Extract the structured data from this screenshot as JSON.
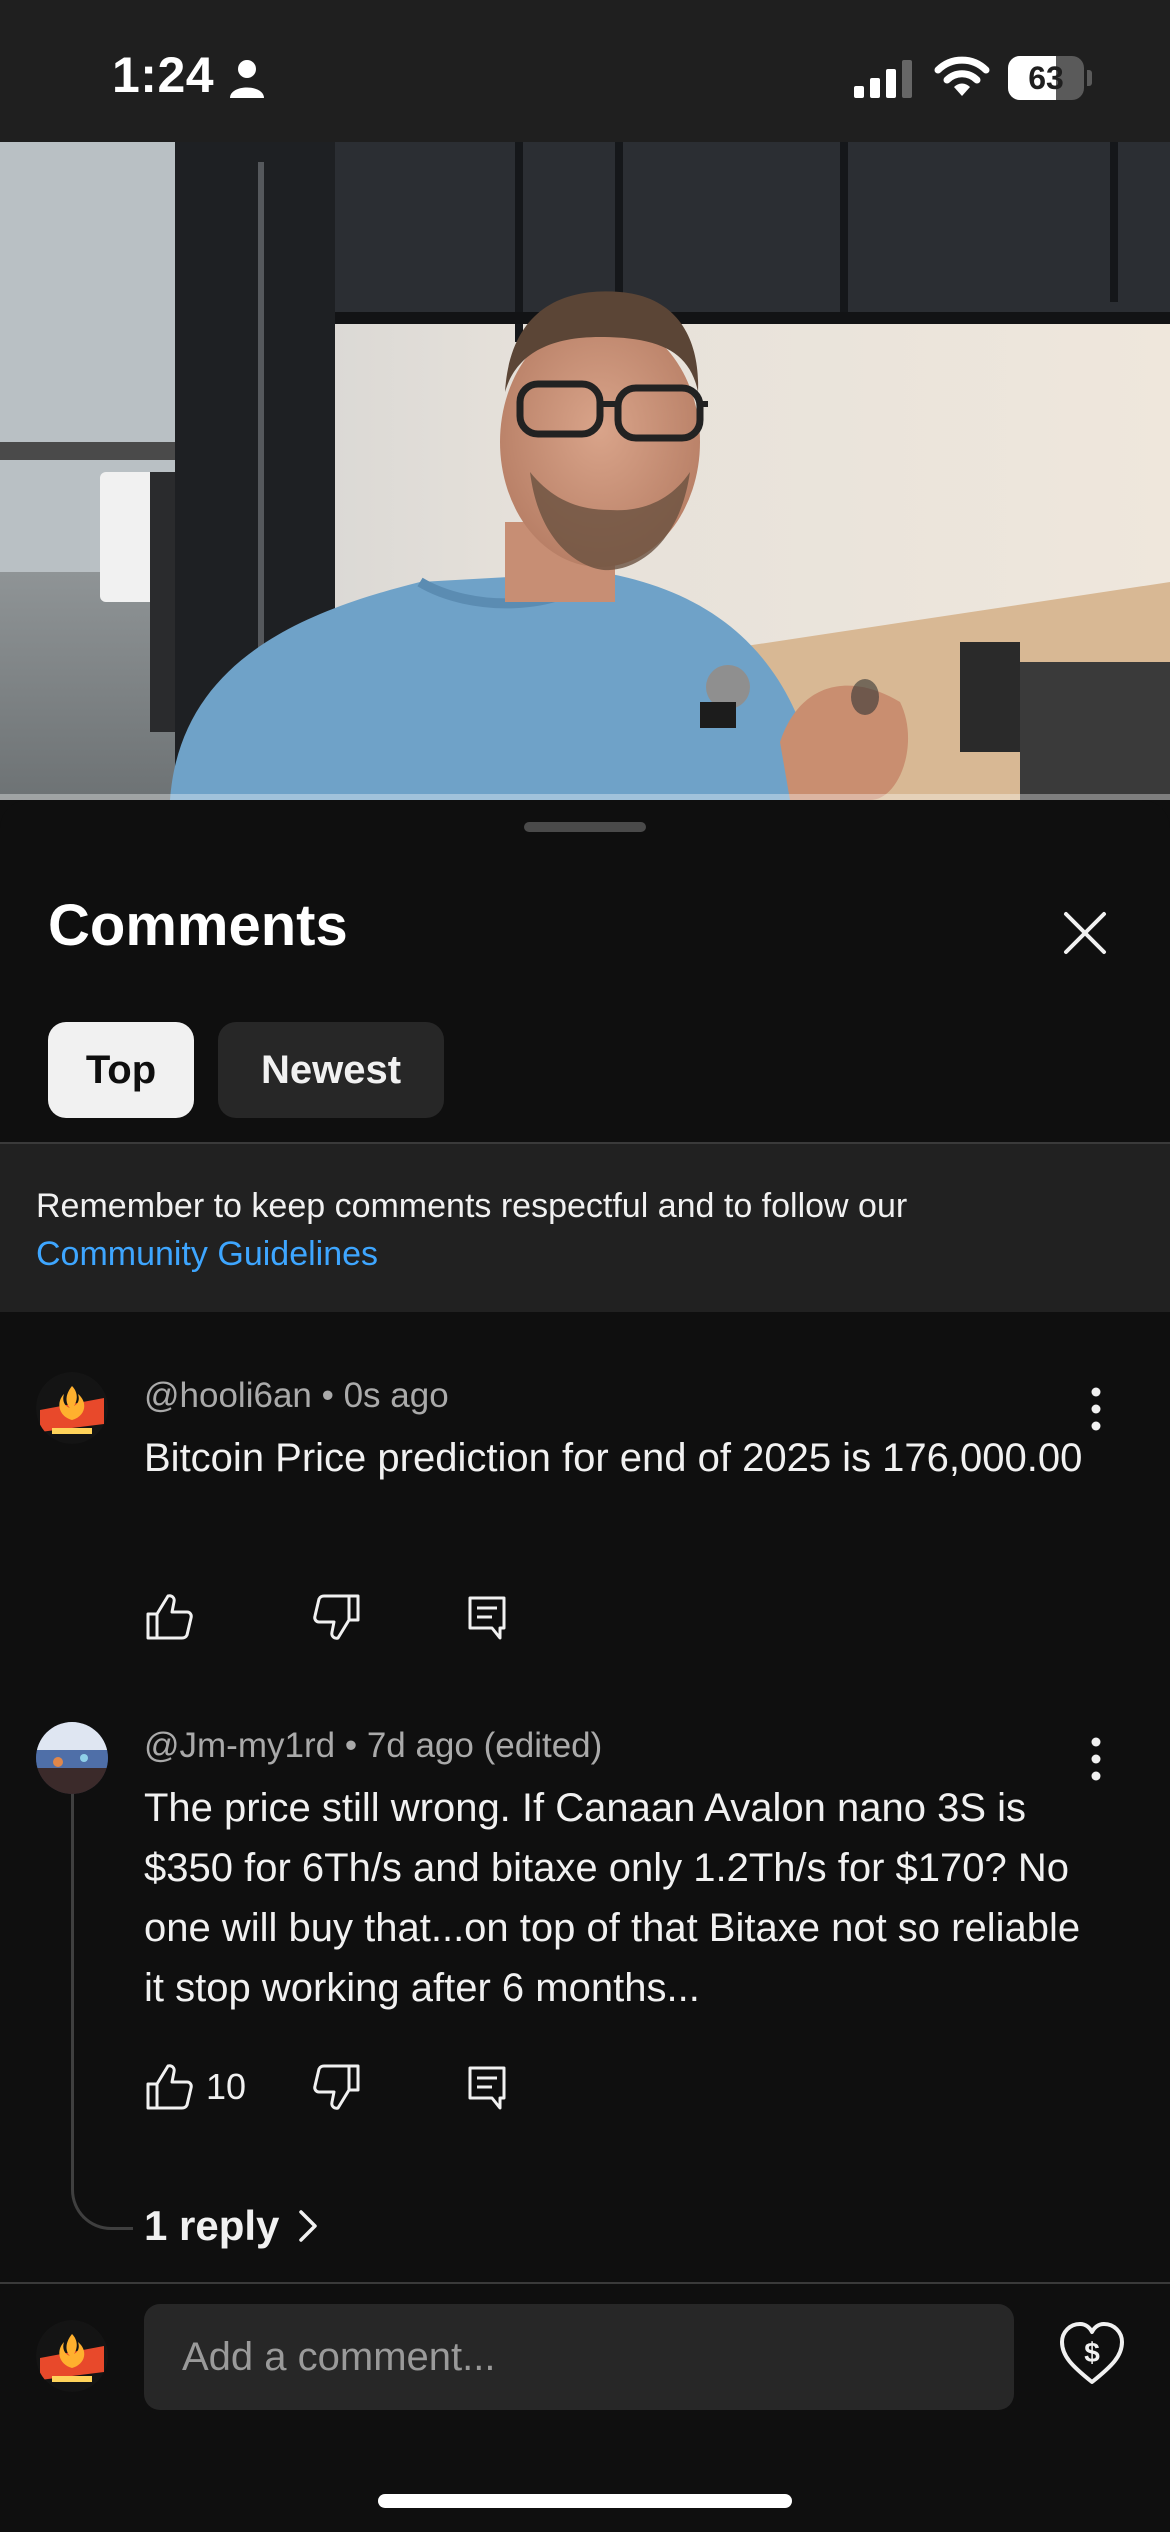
{
  "status_bar": {
    "time": "1:24",
    "battery_level": "63",
    "battery_fraction": 0.63
  },
  "video": {
    "progress_fraction": 0.0
  },
  "comments_panel": {
    "title": "Comments",
    "filters": [
      "Top",
      "Newest"
    ],
    "selected_filter": "Top",
    "guidelines_text": "Remember to keep comments respectful and to follow our",
    "guidelines_link": "Community Guidelines"
  },
  "comments": [
    {
      "author": "@hooli6an",
      "age": "0s ago",
      "edited": "",
      "text": "Bitcoin Price prediction for end of 2025 is 176,000.00",
      "likes": "",
      "avatar_icon": "flame-logo-avatar"
    },
    {
      "author": "@Jm-my1rd",
      "age": "7d ago",
      "edited": "(edited)",
      "text": "The price still wrong. If Canaan Avalon nano 3S is $350 for 6Th/s and bitaxe only 1.2Th/s for $170? No one will buy that...on top of that Bitaxe not so reliable it stop working after 6 months...",
      "likes": "10",
      "replies_label": "1 reply",
      "avatar_icon": "aquarium-photo-avatar"
    }
  ],
  "composer": {
    "placeholder": "Add a comment..."
  },
  "colors": {
    "background": "#0f0f0f",
    "link": "#3ea6ff",
    "chip_selected": "#f1f1f1",
    "chip_default": "#272727"
  }
}
